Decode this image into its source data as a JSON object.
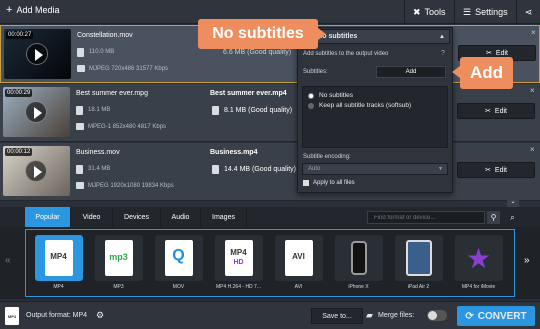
{
  "toolbar": {
    "add_media": "Add Media",
    "tools": "Tools",
    "settings": "Settings"
  },
  "files": [
    {
      "duration": "00:00:27",
      "name": "Constellation.mov",
      "size": "110.0 MB",
      "info": "MJPEG 720x486 31577 Kbps",
      "output_name": "",
      "output_size": "6.6 MB (Good quality)",
      "edit": "Edit"
    },
    {
      "duration": "00:00:29",
      "name": "Best summer ever.mpg",
      "size": "18.1 MB",
      "info": "MPEG-1 852x480 4817 Kbps",
      "output_name": "Best summer ever.mp4",
      "output_size": "8.1 MB (Good quality)",
      "edit": "Edit"
    },
    {
      "duration": "00:00:12",
      "name": "Business.mov",
      "size": "31.4 MB",
      "info": "MJPEG 1920x1080 19834 Kbps",
      "output_name": "Business.mp4",
      "output_size": "14.4 MB (Good quality)",
      "edit": "Edit"
    }
  ],
  "subtitles_panel": {
    "dropdown": "No subtitles",
    "header": "Add subtitles to the output video",
    "subtitles_label": "Subtitles:",
    "add_button": "Add",
    "options": [
      "No subtitles",
      "Keep all subtitle tracks (softsub)"
    ],
    "encoding_label": "Subtitle encoding:",
    "encoding_value": "Auto",
    "apply_all": "Apply to all files"
  },
  "callouts": {
    "no_subtitles": "No subtitles",
    "add": "Add"
  },
  "format_tabs": [
    "Popular",
    "Video",
    "Devices",
    "Audio",
    "Images"
  ],
  "search_placeholder": "Find format or device...",
  "formats": [
    {
      "icon": "MP4",
      "label": "MP4"
    },
    {
      "icon": "mp3",
      "label": "MP3"
    },
    {
      "icon": "Q",
      "label": "MOV"
    },
    {
      "icon": "MP4 HD",
      "label": "MP4 H.264 - HD 7..."
    },
    {
      "icon": "AVI",
      "label": "AVI"
    },
    {
      "icon": "phone",
      "label": "iPhone X"
    },
    {
      "icon": "tablet",
      "label": "iPad Air 2"
    },
    {
      "icon": "star",
      "label": "MP4 for iMovie"
    }
  ],
  "bottom": {
    "output_format": "Output format: MP4",
    "save_to": "Save to...",
    "merge_files": "Merge files:",
    "convert": "CONVERT"
  }
}
